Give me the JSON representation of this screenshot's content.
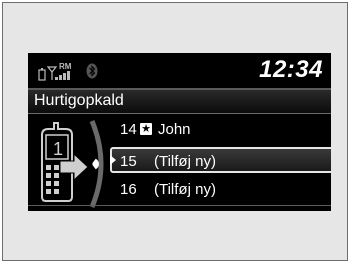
{
  "status": {
    "signal_label": "RM",
    "clock": "12:34",
    "icons": [
      "battery-icon",
      "signal-strength-icon",
      "bluetooth-icon"
    ]
  },
  "header": {
    "title": "Hurtigopkald"
  },
  "speed_dial": {
    "items": [
      {
        "number": "14",
        "has_voice_tag": true,
        "label": "John",
        "selected": false
      },
      {
        "number": "15",
        "has_voice_tag": false,
        "label": "(Tilføj ny)",
        "selected": true
      },
      {
        "number": "16",
        "has_voice_tag": false,
        "label": "(Tilføj ny)",
        "selected": false
      }
    ]
  },
  "colors": {
    "screen_bg": "#000000",
    "text": "#ffffff",
    "selection_border": "#e6e6e6",
    "frame_bg": "#e6e6e6"
  }
}
